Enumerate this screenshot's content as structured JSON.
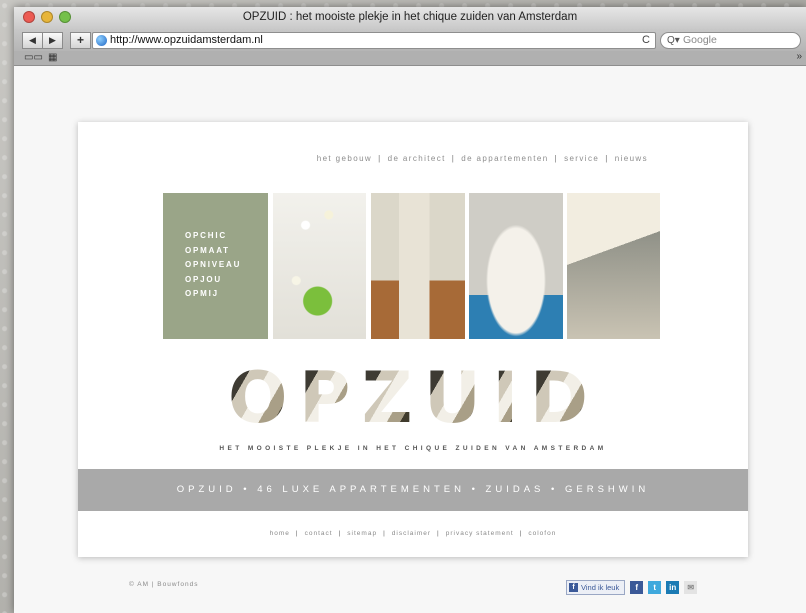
{
  "window": {
    "title": "OPZUID : het mooiste plekje in het chique zuiden van Amsterdam"
  },
  "toolbar": {
    "back_label": "◀",
    "forward_label": "▶",
    "add_label": "+",
    "url": "http://www.opzuidamsterdam.nl",
    "reload_label": "C",
    "search_placeholder": "Google"
  },
  "page": {
    "top_nav": [
      "het gebouw",
      "de architect",
      "de appartementen",
      "service",
      "nieuws"
    ],
    "side_menu": [
      "OPCHIC",
      "OPMAAT",
      "OPNIVEAU",
      "OPJOU",
      "OPMIJ"
    ],
    "logo_letters": [
      "O",
      "P",
      "Z",
      "U",
      "I",
      "D"
    ],
    "tagline": "HET MOOISTE PLEKJE IN HET CHIQUE ZUIDEN VAN AMSTERDAM",
    "band_text": "OPZUID • 46 LUXE APPARTEMENTEN • ZUIDAS • GERSHWIN",
    "footer_nav": [
      "home",
      "contact",
      "sitemap",
      "disclaimer",
      "privacy statement",
      "colofon"
    ],
    "copyright": "© AM | Bouwfonds",
    "like_label": "Vind ik leuk"
  },
  "colors": {
    "side_menu_bg": "#9aa588",
    "band_bg": "#a9a9a9"
  }
}
